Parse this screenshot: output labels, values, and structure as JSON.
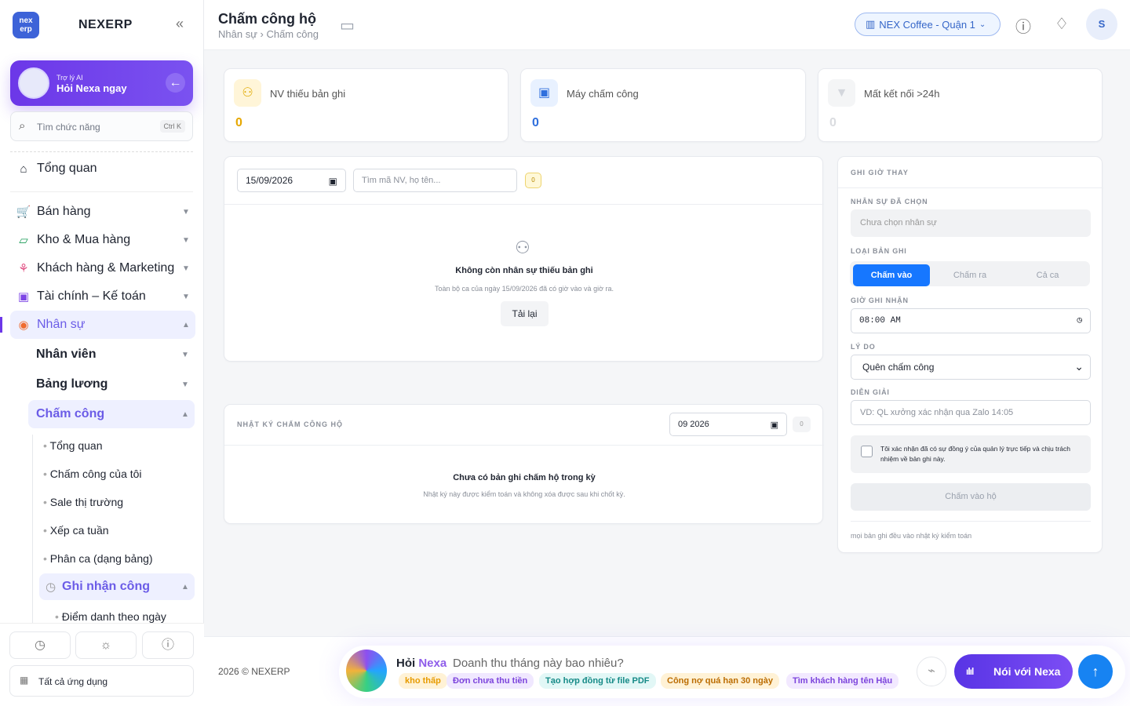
{
  "brand": {
    "logo": "nex\nerp",
    "name": "NEXERP"
  },
  "assistant": {
    "small": "Trợ lý AI",
    "big": "Hỏi Nexa ngay"
  },
  "search": {
    "placeholder": "Tìm chức năng",
    "shortcut": "Ctrl K"
  },
  "sidebar": {
    "overview": "Tổng quan",
    "items": [
      {
        "label": "Bán hàng",
        "icon": "cart-icon"
      },
      {
        "label": "Kho & Mua hàng",
        "icon": "bag-icon"
      },
      {
        "label": "Khách hàng & Marketing",
        "icon": "users-group-icon"
      },
      {
        "label": "Tài chính – Kế toán",
        "icon": "calculator-icon"
      },
      {
        "label": "Nhân sự",
        "icon": "person-badge-icon"
      }
    ],
    "hr_children": [
      "Nhân viên",
      "Bảng lương",
      "Chấm công"
    ],
    "attendance_children": [
      "Tổng quan",
      "Chấm công của tôi",
      "Sale thị trường",
      "Xếp ca tuần",
      "Phân ca (dạng bảng)",
      "Ghi nhận công",
      "Điểm danh theo ngày"
    ],
    "all_apps": "Tất cả ứng dụng"
  },
  "header": {
    "title": "Chấm công hộ",
    "breadcrumb": "Nhân sự › Chấm công",
    "store": "NEX Coffee - Quận 1",
    "avatar": "S"
  },
  "stats": [
    {
      "label": "NV thiếu bản ghi",
      "value": "0",
      "color": "#e6a700",
      "icon": "users-icon"
    },
    {
      "label": "Máy chấm công",
      "value": "0",
      "color": "#2f6fdd",
      "icon": "devices-icon"
    },
    {
      "label": "Mất kết nối >24h",
      "value": "0",
      "color": "#d7d9de",
      "icon": "filter-icon"
    }
  ],
  "missing": {
    "date": "15/09/2026",
    "search_placeholder": "Tìm mã NV, họ tên...",
    "count": "0",
    "empty_title": "Không còn nhân sự thiếu bản ghi",
    "empty_sub": "Toàn bộ ca của ngày 15/09/2026 đã có giờ vào và giờ ra.",
    "reload": "Tải lại"
  },
  "journal": {
    "title": "NHẬT KÝ CHẤM CÔNG HỘ",
    "month": "09 2026",
    "count": "0",
    "empty_title": "Chưa có bản ghi chấm hộ trong kỳ",
    "empty_sub": "Nhật ký này được kiểm toán và không xóa được sau khi chốt kỳ."
  },
  "form": {
    "title": "GHI GIỜ THAY",
    "selected_label": "NHÂN SỰ ĐÃ CHỌN",
    "selected_placeholder": "Chưa chọn nhân sự",
    "type_label": "LOẠI BẢN GHI",
    "types": [
      "Chấm vào",
      "Chấm ra",
      "Cả ca"
    ],
    "time_label": "GIỜ GHI NHẬN",
    "time": "08:00 AM",
    "reason_label": "LÝ DO",
    "reason": "Quên chấm công",
    "note_label": "DIỄN GIẢI",
    "note_placeholder": "VD: QL xưởng xác nhận qua Zalo 14:05",
    "consent": "Tôi xác nhận đã có sự đồng ý của quản lý trực tiếp và chịu trách nhiệm về bản ghi này.",
    "submit": "Chấm vào hộ",
    "footer": "mọi bản ghi đều vào nhật ký kiểm toán"
  },
  "footer": {
    "copyright": "2026 © NEXERP"
  },
  "nexa": {
    "ask": "Hỏi",
    "name": "Nexa",
    "question": "Doanh thu tháng này bao nhiêu?",
    "chips": [
      "kho thấp",
      "Đơn chưa thu tiền",
      "Tạo hợp đồng từ file PDF",
      "Công nợ quá hạn 30 ngày",
      "Tìm khách hàng tên Hậu"
    ],
    "talk": "Nói với Nexa"
  },
  "colors": {
    "primary": "#6c37e8",
    "blue": "#2f6fdd",
    "active": "#1677ff"
  }
}
